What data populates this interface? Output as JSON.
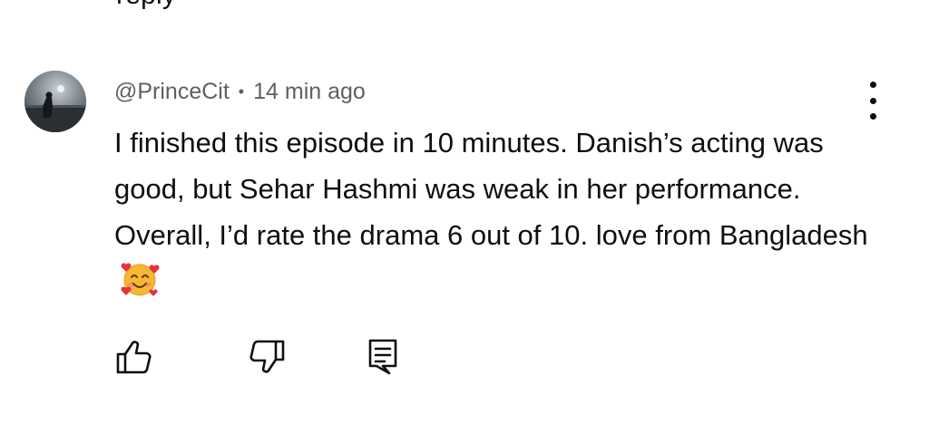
{
  "previous_comment": {
    "tail_text": "reply"
  },
  "comment": {
    "author": "@PrinceCit",
    "separator": "•",
    "time": "14 min ago",
    "text": "I finished this episode in 10 minutes. Danish’s acting was good, but Sehar Hashmi was weak in her performance. Overall, I’d rate the drama 6 out of 10. love from Bangladesh",
    "emoji": "smiling-face-with-hearts"
  },
  "icons": {
    "menu": "more-vert-icon",
    "like": "thumb-up-icon",
    "dislike": "thumb-down-icon",
    "reply": "comment-reply-icon"
  },
  "colors": {
    "text": "#0f0f0f",
    "meta": "#606060",
    "background": "#ffffff"
  }
}
